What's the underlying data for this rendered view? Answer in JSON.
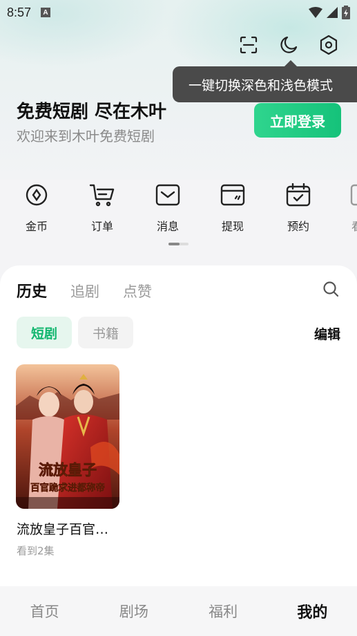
{
  "status_bar": {
    "time": "8:57",
    "notification_letter": "A"
  },
  "tooltip": {
    "text": "一键切换深色和浅色模式"
  },
  "header": {
    "headline": "免费短剧 尽在木叶",
    "subline": "欢迎来到木叶免费短剧",
    "login_label": "立即登录"
  },
  "quick_actions": [
    {
      "label": "金币",
      "icon": "coin-icon"
    },
    {
      "label": "订单",
      "icon": "cart-icon"
    },
    {
      "label": "消息",
      "icon": "message-icon"
    },
    {
      "label": "提现",
      "icon": "wallet-icon"
    },
    {
      "label": "预约",
      "icon": "calendar-icon"
    },
    {
      "label": "看剧",
      "icon": "watch-icon"
    }
  ],
  "tabs": [
    "历史",
    "追剧",
    "点赞"
  ],
  "chips": [
    "短剧",
    "书籍"
  ],
  "edit_label": "编辑",
  "history_item": {
    "title": "流放皇子百官…",
    "progress": "看到2集",
    "poster_title_line1": "流放皇子",
    "poster_title_line2": "百官跪求进都称帝"
  },
  "bottom_nav": [
    "首页",
    "剧场",
    "福利",
    "我的"
  ],
  "colors": {
    "accent": "#15c27a",
    "tooltip_bg": "#4a4a4a"
  }
}
